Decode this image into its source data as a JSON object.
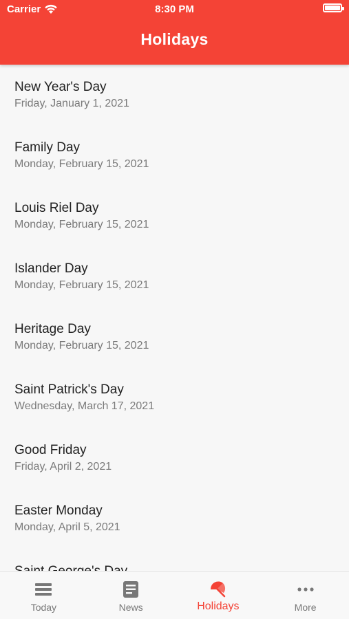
{
  "status_bar": {
    "carrier": "Carrier",
    "time": "8:30 PM"
  },
  "header": {
    "title": "Holidays"
  },
  "holidays": [
    {
      "name": "New Year's Day",
      "date": "Friday, January 1, 2021"
    },
    {
      "name": "Family Day",
      "date": "Monday, February 15, 2021"
    },
    {
      "name": "Louis Riel Day",
      "date": "Monday, February 15, 2021"
    },
    {
      "name": "Islander Day",
      "date": "Monday, February 15, 2021"
    },
    {
      "name": "Heritage Day",
      "date": "Monday, February 15, 2021"
    },
    {
      "name": "Saint Patrick's Day",
      "date": "Wednesday, March 17, 2021"
    },
    {
      "name": "Good Friday",
      "date": "Friday, April 2, 2021"
    },
    {
      "name": "Easter Monday",
      "date": "Monday, April 5, 2021"
    },
    {
      "name": "Saint George's Day",
      "date": ""
    }
  ],
  "tabs": [
    {
      "label": "Today",
      "icon": "menu-lines-icon",
      "active": false
    },
    {
      "label": "News",
      "icon": "document-icon",
      "active": false
    },
    {
      "label": "Holidays",
      "icon": "beach-umbrella-icon",
      "active": true
    },
    {
      "label": "More",
      "icon": "more-dots-icon",
      "active": false
    }
  ],
  "colors": {
    "accent": "#f44336",
    "inactive": "#777777"
  }
}
